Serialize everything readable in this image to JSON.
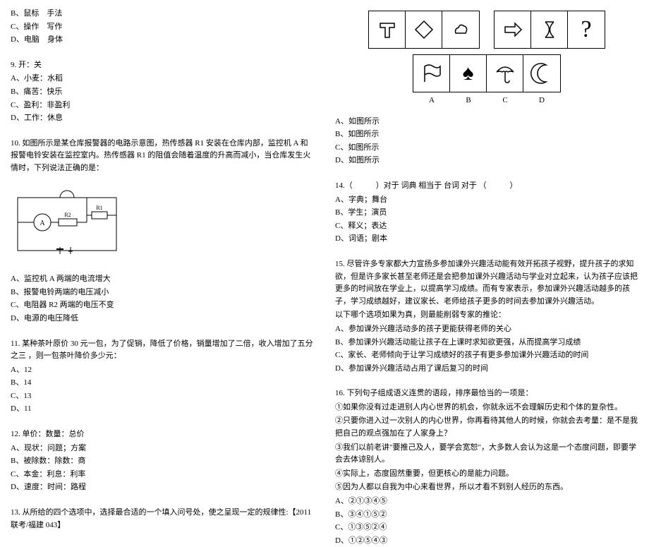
{
  "left": {
    "q8_tail": {
      "B": "B、鼠标　手法",
      "C": "C、操作　写作",
      "D": "D、电脑　身体"
    },
    "q9": {
      "stem": "9. 开：关",
      "A": "A、小麦：水稻",
      "B": "B、痛苦：快乐",
      "C": "C、盈利：非盈利",
      "D": "D、工作：休息"
    },
    "q10": {
      "stem": "10. 如图所示是某仓库报警器的电路示意图，热传感器 R1 安装在仓库内部，监控机 A 和报警电铃安装在监控室内。热传感器 R1 的阻值会随着温度的升高而减小，当仓库发生火情时，下列说法正确的是：",
      "A": "A、监控机 A 两端的电流增大",
      "B": "B、报警电铃两端的电压减小",
      "C": "C、电阻器 R2 两端的电压不变",
      "D": "D、电源的电压降低"
    },
    "q11": {
      "stem": "11. 某种茶叶原价 30 元一包，为了促销，降低了价格，销量增加了二倍，收入增加了五分之三 ，则一包茶叶降价多少元：",
      "A": "A、12",
      "B": "B、14",
      "C": "C、13",
      "D": "D、11"
    },
    "q12": {
      "stem": "12. 单价：数量：总价",
      "A": "A、现状：问题；方案",
      "B": "B、被除数：除数：商",
      "C": "C、本金：利息：利率",
      "D": "D、速度：时间：路程"
    },
    "q13": {
      "stem": "13. 从所给的四个选项中，选择最合适的一个填入问号处，使之呈现一定的规律性:【2011 联考/福建 043】"
    }
  },
  "right": {
    "figure_labels": {
      "A": "A",
      "B": "B",
      "C": "C",
      "D": "D"
    },
    "q13_opts": {
      "A": "A、如图所示",
      "B": "B、如图所示",
      "C": "C、如图所示",
      "D": "D、如图所示"
    },
    "q14": {
      "stem": "14.（　　　）对于 词典 相当于 台词 对于 （　　　）",
      "A": "A、字典；舞台",
      "B": "B、学生；演员",
      "C": "C、释义；表达",
      "D": "D、词语；剧本"
    },
    "q15": {
      "stem": "15. 尽管许多专家都大力宣扬多参加课外兴趣活动能有效开拓孩子视野，提升孩子的求知欲，但是许多家长甚至老师还是会把参加课外兴趣活动与学业对立起来，认为孩子应该把更多的时间放在学业上，以提高学习成绩。而有专家表示，参加课外兴趣活动越多的孩子，学习成绩越好，建议家长、老师给孩子更多的时间去参加课外兴趣活动。",
      "sub": "以下哪个选项如果为真，则最能削弱专家的推论：",
      "A": "A、参加课外兴趣活动多的孩子更能获得老师的关心",
      "B": "B、参加课外兴趣活动能让孩子在上课时求知欲更强，从而提高学习成绩",
      "C": "C、家长、老师倾向于让学习成绩好的孩子有更多参加课外兴趣活动的时间",
      "D": "D、参加课外兴趣活动占用了课后复习的时间"
    },
    "q16": {
      "stem": "16. 下列句子组成语义连贯的语段，排序最恰当的一项是：",
      "s1": "①如果你没有过走进别人内心世界的机会，你就永远不会理解历史和个体的复杂性。",
      "s2": "②只要你进入过一次别人的内心世界，你再看待其他人的时候，你就会去考量：是不是我把自己的观点强加在了人家身上？",
      "s3": "③我们以前老讲\"要推己及人，要学会宽恕\"，大多数人会认为这是一个态度问题，即要学会去体谅别人。",
      "s4": "④实际上，态度固然重要，但更核心的是能力问题。",
      "s5": "⑤因为人都以自我为中心来看世界，所以才看不到别人经历的东西。",
      "A": "A、②①③④⑤",
      "B": "B、③④①⑤②",
      "C": "C、①③⑤②④",
      "D": "D、①②⑤④③"
    }
  }
}
